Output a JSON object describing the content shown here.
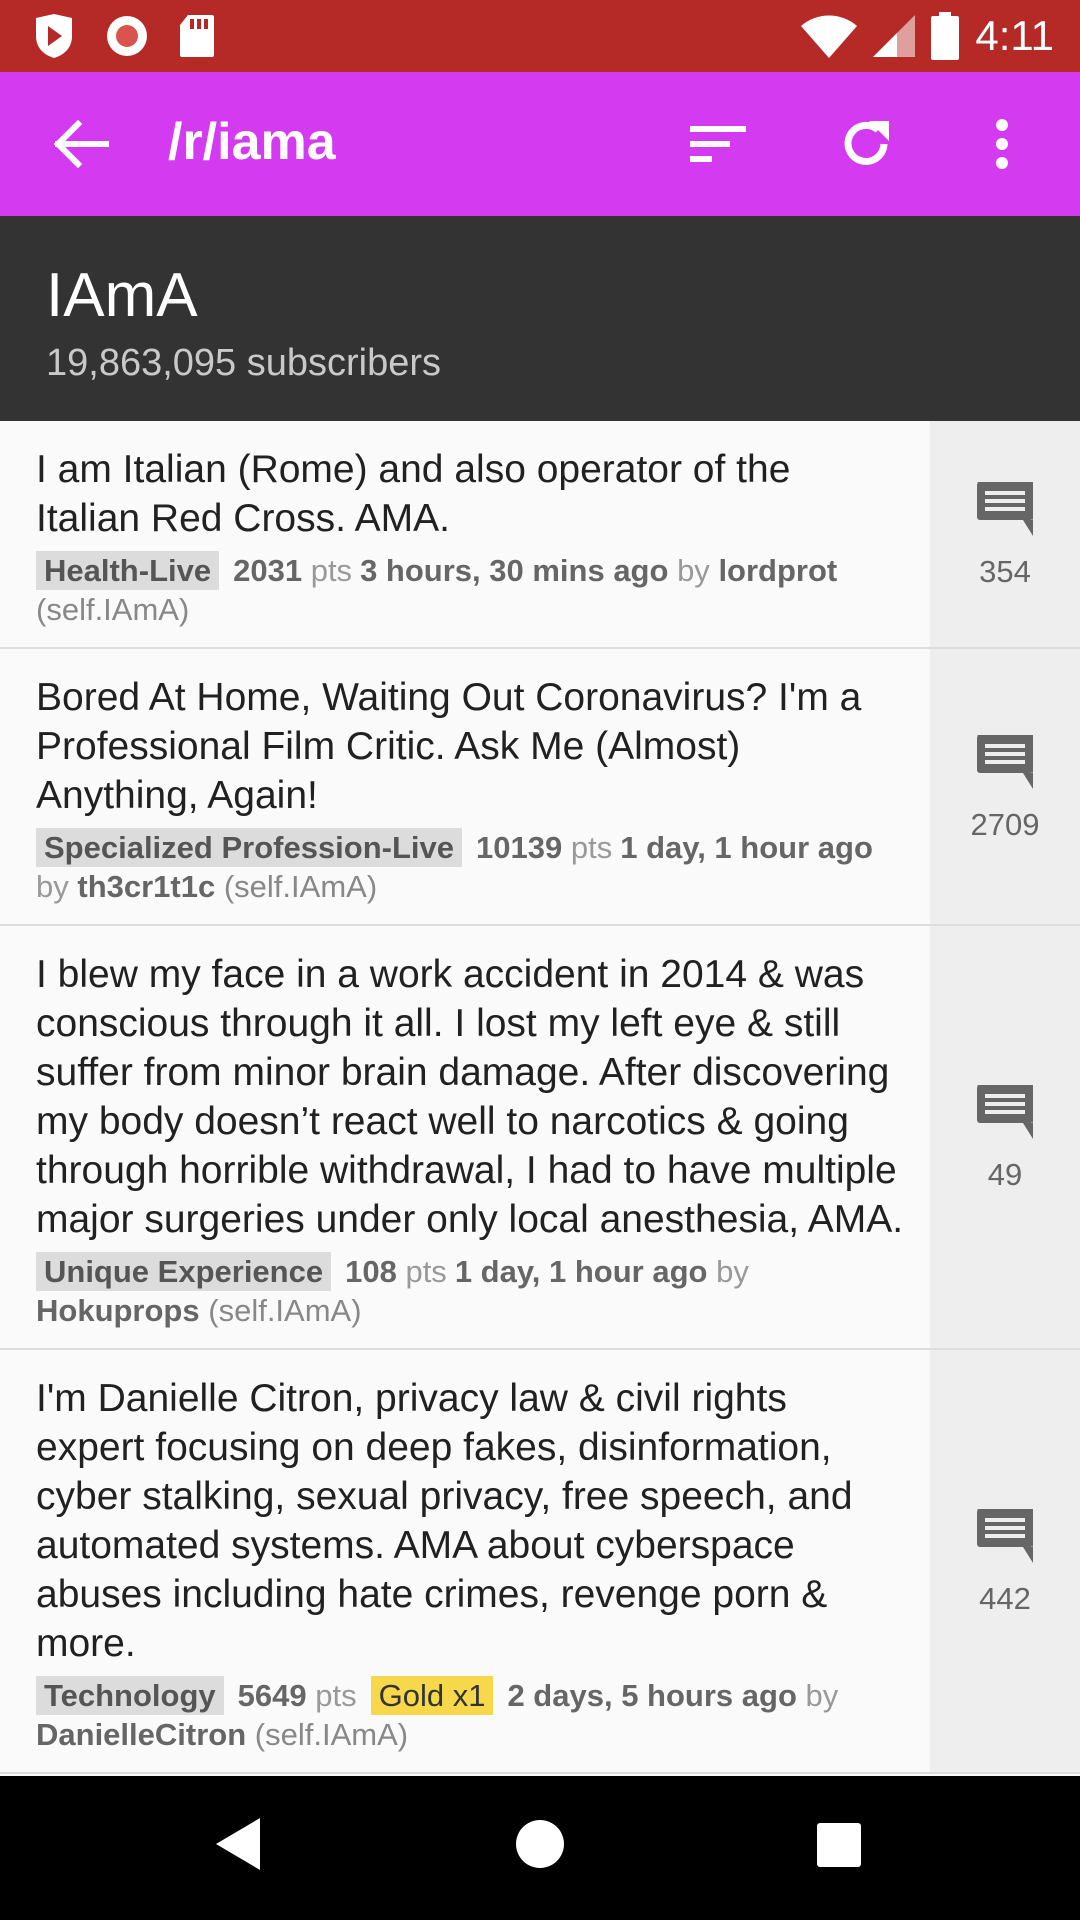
{
  "status_bar": {
    "time": "4:11",
    "icons": [
      "shield-icon",
      "record-icon",
      "sd-card-icon",
      "wifi-icon",
      "cell-signal-icon",
      "battery-icon"
    ]
  },
  "toolbar": {
    "title": "/r/iama",
    "background": "#d43af0",
    "icons": [
      "back-arrow-icon",
      "sort-icon",
      "refresh-icon",
      "more-vert-icon"
    ]
  },
  "subreddit": {
    "name": "IAmA",
    "subscribers": "19,863,095 subscribers"
  },
  "posts": [
    {
      "title": "I am Italian (Rome) and also operator of the Italian Red Cross. AMA.",
      "flair": "Health-Live",
      "points": "2031",
      "points_label": "pts",
      "gold": "",
      "time": "3 hours, 30 mins ago",
      "by": "by",
      "author": "lordprot",
      "domain": "(self.IAmA)",
      "comments": "354"
    },
    {
      "title": "Bored At Home, Waiting Out Coronavirus? I'm a Professional Film Critic. Ask Me (Almost) Anything, Again!",
      "flair": "Specialized Profession-Live",
      "points": "10139",
      "points_label": "pts",
      "gold": "",
      "time": "1 day, 1 hour ago",
      "by": "by",
      "author": "th3cr1t1c",
      "domain": "(self.IAmA)",
      "comments": "2709"
    },
    {
      "title": "I blew my face in a work accident in 2014 & was conscious through it all. I lost my left eye & still suffer from minor brain damage. After discovering my body doesn’t react well to narcotics & going through horrible withdrawal, I had to have multiple major surgeries under only local anesthesia, AMA.",
      "flair": "Unique Experience",
      "points": "108",
      "points_label": "pts",
      "gold": "",
      "time": "1 day, 1 hour ago",
      "by": "by",
      "author": "Hokuprops",
      "domain": "(self.IAmA)",
      "comments": "49"
    },
    {
      "title": "I'm Danielle Citron, privacy law & civil rights expert focusing on deep fakes, disinformation, cyber stalking, sexual privacy, free speech, and automated systems. AMA about cyberspace abuses including hate crimes, revenge porn & more.",
      "flair": "Technology",
      "points": "5649",
      "points_label": "pts",
      "gold": "Gold x1",
      "time": "2 days, 5 hours ago",
      "by": "by",
      "author": "DanielleCitron",
      "domain": "(self.IAmA)",
      "comments": "442"
    }
  ],
  "nav_bar": {
    "icons": [
      "nav-back-icon",
      "nav-home-icon",
      "nav-recents-icon"
    ]
  }
}
